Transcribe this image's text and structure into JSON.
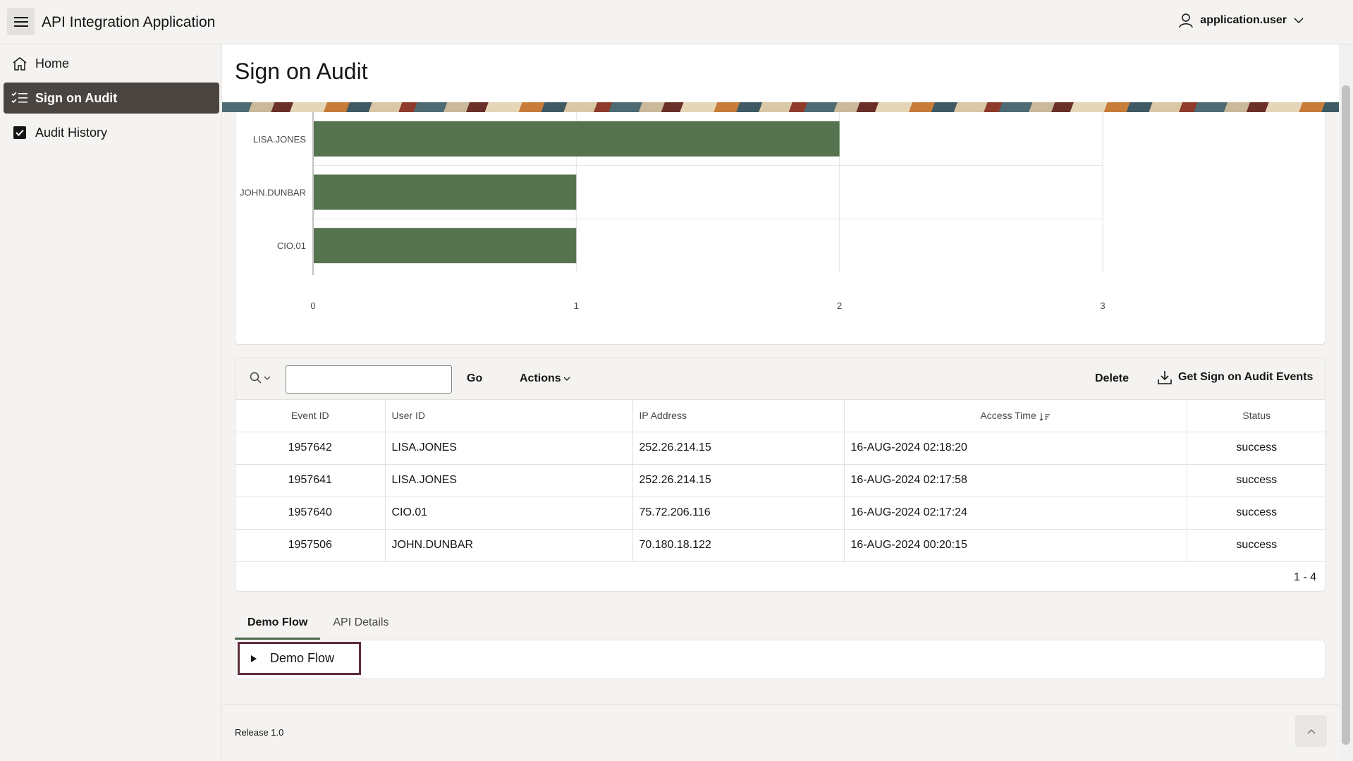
{
  "app": {
    "title": "API Integration Application",
    "user": "application.user"
  },
  "sidebar": {
    "items": [
      {
        "label": "Home",
        "icon": "home-icon"
      },
      {
        "label": "Sign on Audit",
        "icon": "checklist-icon",
        "active": true
      },
      {
        "label": "Audit History",
        "icon": "checkbox-icon"
      }
    ]
  },
  "page": {
    "title": "Sign on Audit"
  },
  "chart_data": {
    "type": "bar",
    "orientation": "horizontal",
    "categories": [
      "LISA.JONES",
      "JOHN.DUNBAR",
      "CIO.01"
    ],
    "values": [
      2,
      1,
      1
    ],
    "xlim": [
      0,
      3
    ],
    "xticks": [
      "0",
      "1",
      "2",
      "3"
    ],
    "grid": true,
    "bar_color": "#56734f"
  },
  "report": {
    "search": {
      "placeholder": "",
      "value": ""
    },
    "go_label": "Go",
    "actions_label": "Actions",
    "delete_label": "Delete",
    "get_label": "Get Sign on Audit Events",
    "columns": [
      "Event ID",
      "User ID",
      "IP Address",
      "Access Time",
      "Status"
    ],
    "rows": [
      [
        "1957642",
        "LISA.JONES",
        "252.26.214.15",
        "16-AUG-2024 02:18:20",
        "success"
      ],
      [
        "1957641",
        "LISA.JONES",
        "252.26.214.15",
        "16-AUG-2024 02:17:58",
        "success"
      ],
      [
        "1957640",
        "CIO.01",
        "75.72.206.116",
        "16-AUG-2024 02:17:24",
        "success"
      ],
      [
        "1957506",
        "JOHN.DUNBAR",
        "70.180.18.122",
        "16-AUG-2024 00:20:15",
        "success"
      ]
    ],
    "pagination": "1 - 4"
  },
  "tabs": [
    {
      "label": "Demo Flow",
      "active": true
    },
    {
      "label": "API Details",
      "active": false
    }
  ],
  "demo_flow": {
    "label": "Demo Flow"
  },
  "footer": {
    "release": "Release 1.0"
  }
}
